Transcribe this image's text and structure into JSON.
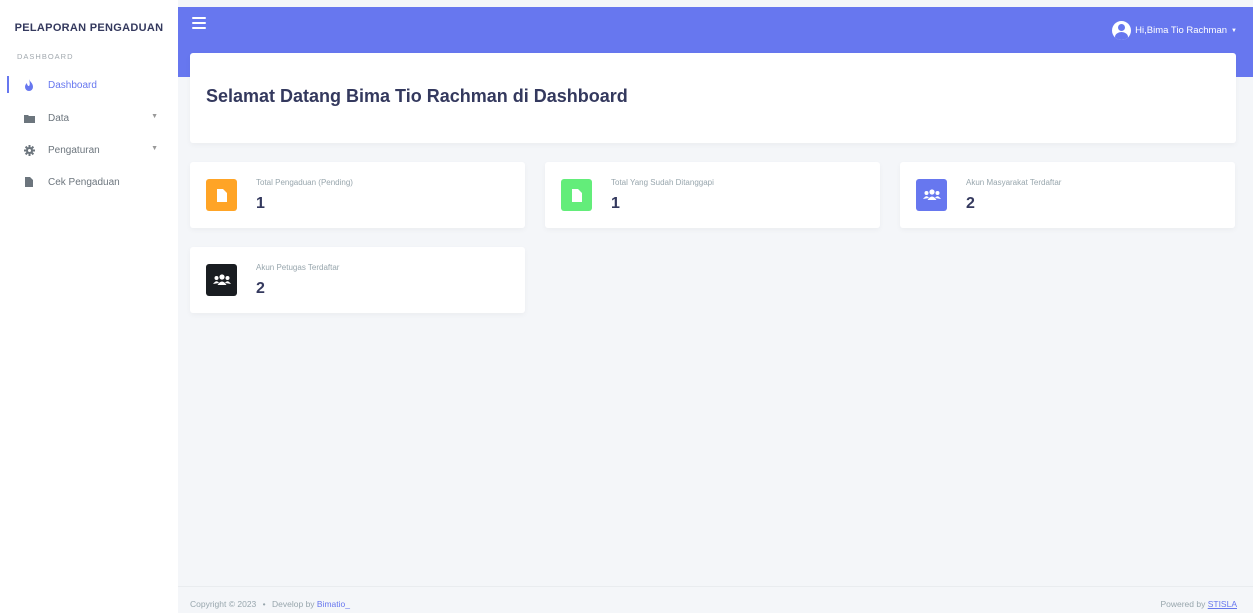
{
  "sidebar": {
    "brand": "PELAPORAN PENGADUAN",
    "menu_header": "DASHBOARD",
    "items": [
      {
        "label": "Dashboard",
        "icon": "fire-icon",
        "active": true
      },
      {
        "label": "Data",
        "icon": "folder-icon",
        "has_caret": true
      },
      {
        "label": "Pengaturan",
        "icon": "gear-icon",
        "has_caret": true
      },
      {
        "label": "Cek Pengaduan",
        "icon": "file-icon"
      }
    ]
  },
  "navbar": {
    "user_label": "Hi,Bima Tio Rachman"
  },
  "welcome": {
    "title": "Selamat Datang Bima Tio Rachman di Dashboard"
  },
  "stats": [
    {
      "title": "Total Pengaduan (Pending)",
      "value": "1",
      "icon": "file-icon",
      "color": "#ffa426"
    },
    {
      "title": "Total Yang Sudah Ditanggapi",
      "value": "1",
      "icon": "file-icon",
      "color": "#63ed7a"
    },
    {
      "title": "Akun Masyarakat Terdaftar",
      "value": "2",
      "icon": "users-icon",
      "color": "#6777ef"
    },
    {
      "title": "Akun Petugas Terdaftar",
      "value": "2",
      "icon": "users-icon",
      "color": "#191d21"
    }
  ],
  "footer": {
    "copyright": "Copyright © 2023",
    "separator": "•",
    "develop_prefix": "Develop by",
    "develop_link": "Bimatio_",
    "powered_prefix": "Powered by",
    "powered_link": "STISLA"
  },
  "colors": {
    "primary": "#6777ef"
  }
}
